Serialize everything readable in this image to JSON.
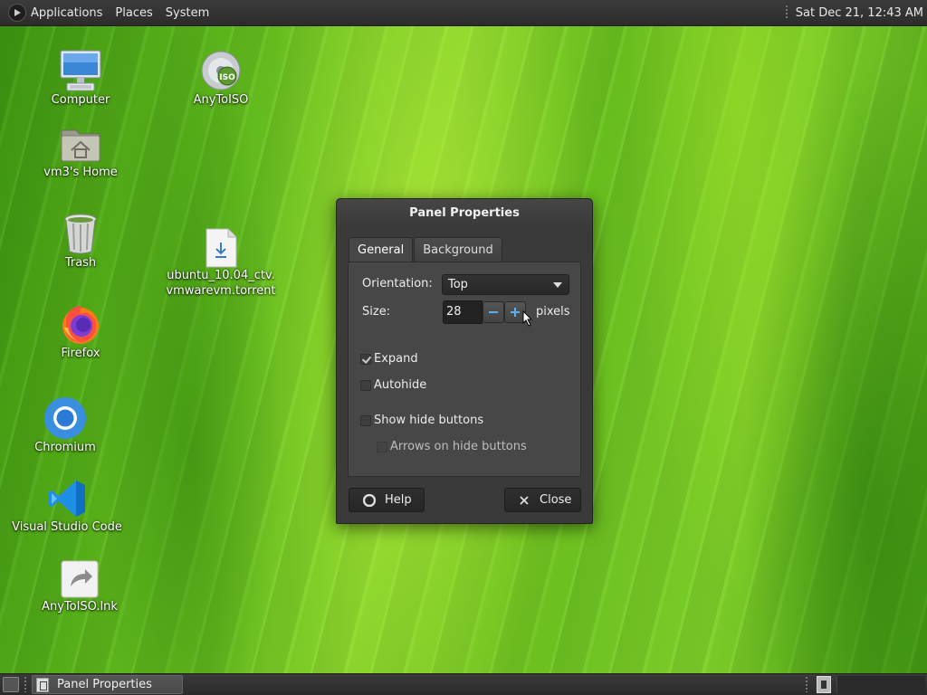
{
  "top_panel": {
    "menus": [
      "Applications",
      "Places",
      "System"
    ],
    "clock": "Sat Dec 21, 12:43 AM"
  },
  "desktop": {
    "icons": [
      {
        "label": "Computer",
        "icon": "computer-monitor-icon"
      },
      {
        "label": "AnyToISO",
        "icon": "iso-disc-icon"
      },
      {
        "label": "vm3's Home",
        "icon": "home-folder-icon"
      },
      {
        "label": "Trash",
        "icon": "trash-icon"
      },
      {
        "label": "ubuntu_10.04_ctv.\nvmwarevm.torrent",
        "label_line1": "ubuntu_10.04_ctv.",
        "label_line2": "vmwarevm.torrent",
        "icon": "torrent-file-icon"
      },
      {
        "label": "Firefox",
        "icon": "firefox-icon"
      },
      {
        "label": "Chromium",
        "icon": "chromium-icon"
      },
      {
        "label": "Visual Studio Code",
        "icon": "vscode-icon"
      },
      {
        "label": "AnyToISO.lnk",
        "icon": "shortcut-icon"
      }
    ]
  },
  "dialog": {
    "title": "Panel Properties",
    "tabs": [
      {
        "label": "General",
        "active": true
      },
      {
        "label": "Background",
        "active": false
      }
    ],
    "orientation": {
      "label": "Orientation:",
      "value": "Top"
    },
    "size": {
      "label": "Size:",
      "value": "28",
      "unit": "pixels"
    },
    "checkboxes": {
      "expand": {
        "label": "Expand",
        "checked": true
      },
      "autohide": {
        "label": "Autohide",
        "checked": false
      },
      "show_hide_buttons": {
        "label": "Show hide buttons",
        "checked": false
      },
      "arrows_on_hide_buttons": {
        "label": "Arrows on hide buttons",
        "checked": false,
        "disabled": true
      }
    },
    "buttons": {
      "help": "Help",
      "close": "Close"
    }
  },
  "bottom_panel": {
    "task": "Panel Properties"
  },
  "colors": {
    "panel_bg": "#2f2f2f",
    "dialog_bg": "#3a3a3a",
    "accent_blue": "#5ab0f0",
    "wallpaper_green": "#7fd22a"
  }
}
